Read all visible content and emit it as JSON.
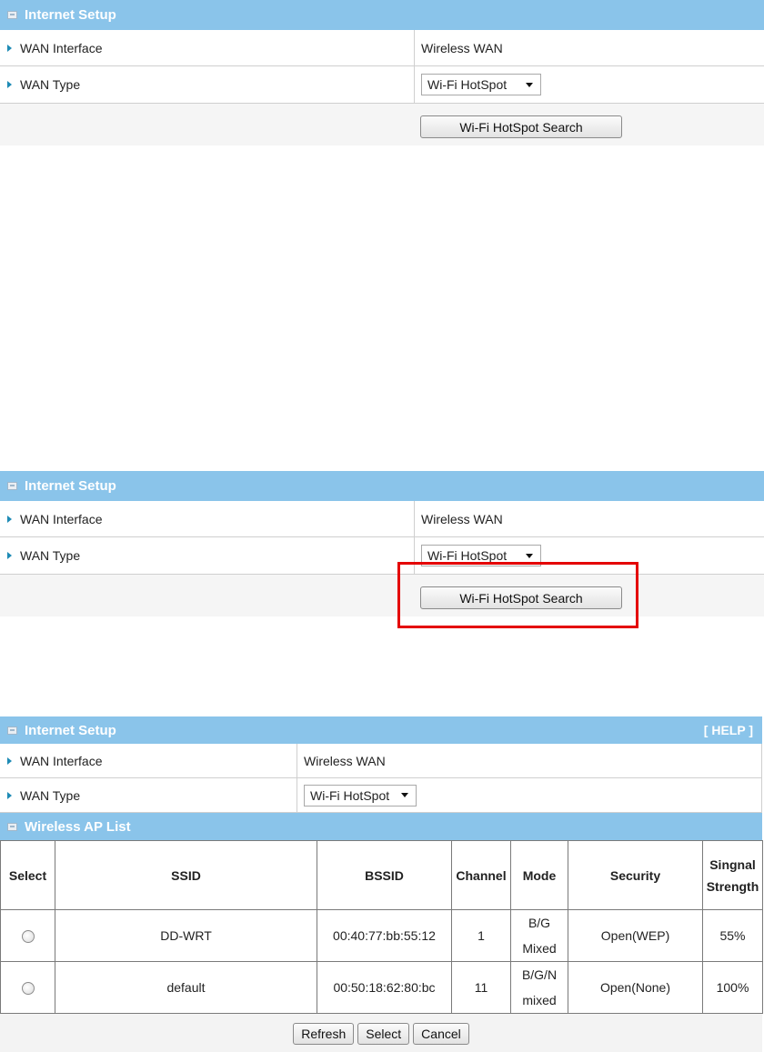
{
  "panel1": {
    "title": "Internet Setup",
    "wan_interface_label": "WAN Interface",
    "wan_interface_value": "Wireless WAN",
    "wan_type_label": "WAN Type",
    "wan_type_value": "Wi-Fi HotSpot",
    "search_button": "Wi-Fi HotSpot Search"
  },
  "panel2": {
    "title": "Internet Setup",
    "wan_interface_label": "WAN Interface",
    "wan_interface_value": "Wireless WAN",
    "wan_type_label": "WAN Type",
    "wan_type_value": "Wi-Fi HotSpot",
    "search_button": "Wi-Fi HotSpot Search"
  },
  "panel3": {
    "title": "Internet Setup",
    "help": "[ HELP ]",
    "wan_interface_label": "WAN Interface",
    "wan_interface_value": "Wireless WAN",
    "wan_type_label": "WAN Type",
    "wan_type_value": "Wi-Fi HotSpot",
    "ap_list_title": "Wireless AP List",
    "columns": {
      "select": "Select",
      "ssid": "SSID",
      "bssid": "BSSID",
      "channel": "Channel",
      "mode": "Mode",
      "security": "Security",
      "signal_line1": "Singnal",
      "signal_line2": "Strength"
    },
    "rows": [
      {
        "ssid": "DD-WRT",
        "bssid": "00:40:77:bb:55:12",
        "channel": "1",
        "mode_line1": "B/G",
        "mode_line2": "Mixed",
        "security": "Open(WEP)",
        "signal": "55%"
      },
      {
        "ssid": "default",
        "bssid": "00:50:18:62:80:bc",
        "channel": "11",
        "mode_line1": "B/G/N",
        "mode_line2": "mixed",
        "security": "Open(None)",
        "signal": "100%"
      }
    ],
    "buttons": {
      "refresh": "Refresh",
      "select": "Select",
      "cancel": "Cancel"
    }
  },
  "colors": {
    "header_bg": "#8ac4ea",
    "highlight": "#e40000"
  }
}
